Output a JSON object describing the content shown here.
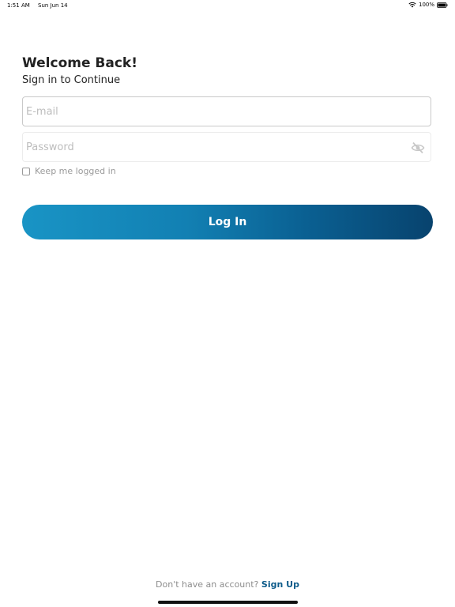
{
  "status_bar": {
    "time": "1:51 AM",
    "date": "Sun Jun 14",
    "battery": "100%"
  },
  "header": {
    "title": "Welcome Back!",
    "subtitle": "Sign in to Continue"
  },
  "form": {
    "email_placeholder": "E-mail",
    "email_value": "",
    "password_placeholder": "Password",
    "password_value": "",
    "remember_label": "Keep me logged in",
    "login_label": "Log In"
  },
  "footer": {
    "prompt": "Don't have an account?",
    "signup_label": "Sign Up"
  },
  "colors": {
    "button_gradient_start": "#1994c5",
    "button_gradient_end": "#08436e",
    "link": "#0d5b8a"
  },
  "icons": {
    "password_toggle": "eye-slash-icon",
    "wifi": "wifi-icon",
    "battery": "battery-icon"
  }
}
